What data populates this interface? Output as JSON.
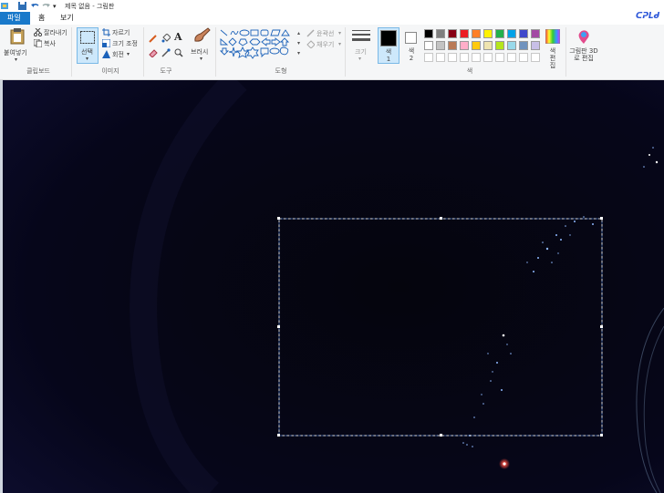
{
  "window": {
    "title": "제목 없음 - 그림판"
  },
  "menu": {
    "file": "파일",
    "home": "홈",
    "view": "보기"
  },
  "clipboard": {
    "paste": "붙여넣기",
    "cut": "잘라내기",
    "copy": "복사",
    "group": "클립보드"
  },
  "image": {
    "select": "선택",
    "crop": "자르기",
    "resize": "크기 조정",
    "rotate": "회전",
    "group": "이미지"
  },
  "tools": {
    "group": "도구"
  },
  "brushes": {
    "label": "브러시"
  },
  "shapes": {
    "outline": "윤곽선",
    "fill": "채우기",
    "group": "도형"
  },
  "size": {
    "label": "크기"
  },
  "colors": {
    "color1": "색 1",
    "color2": "색 2",
    "edit": "색 편집",
    "group": "색",
    "palette": [
      "#000000",
      "#7f7f7f",
      "#880015",
      "#ed1c24",
      "#ff7f27",
      "#fff200",
      "#22b14c",
      "#00a2e8",
      "#3f48cc",
      "#a349a4",
      "#ffffff",
      "#c3c3c3",
      "#b97a57",
      "#ffaec9",
      "#ffc90e",
      "#efe4b0",
      "#b5e61d",
      "#99d9ea",
      "#7092be",
      "#c8bfe7"
    ],
    "empty_count": 10,
    "color1_value": "#000000",
    "color2_value": "#ffffff"
  },
  "paint3d": {
    "label": "그림판 3D로 편집"
  },
  "brand": {
    "logo": "ᑕᕈᒪᑯ"
  }
}
